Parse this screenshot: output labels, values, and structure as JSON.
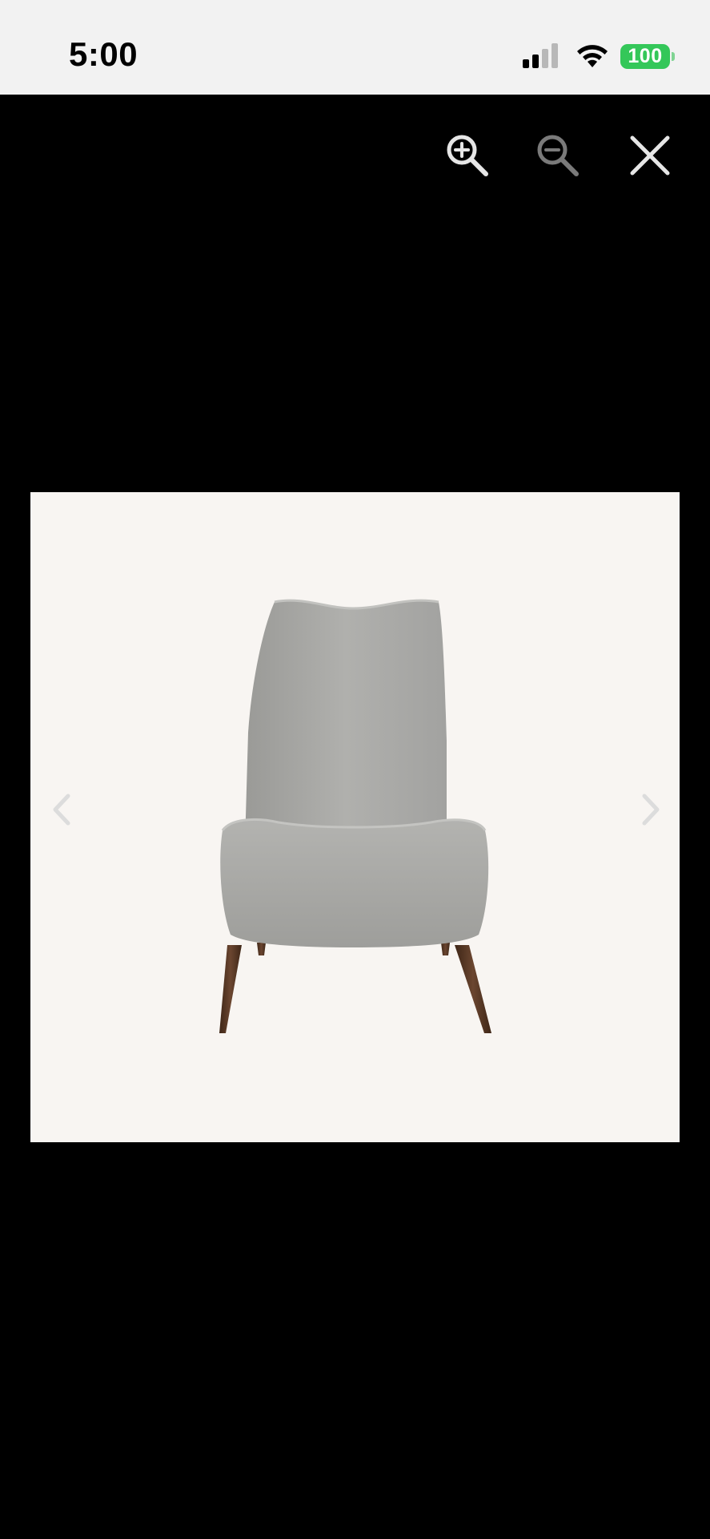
{
  "status_bar": {
    "time": "5:00",
    "battery": "100",
    "battery_color": "#34c759"
  },
  "viewer": {
    "background": "#000000",
    "toolbar": {
      "zoom_in_icon": "zoom-in-icon",
      "zoom_out_icon": "zoom-out-icon",
      "close_icon": "close-icon"
    },
    "image": {
      "subject": "lounge-chair",
      "background": "#f8f5f2",
      "upholstery_color": "#a9a9a6",
      "leg_color": "#5a3a24"
    },
    "navigation": {
      "prev_icon": "chevron-left-icon",
      "next_icon": "chevron-right-icon"
    }
  }
}
